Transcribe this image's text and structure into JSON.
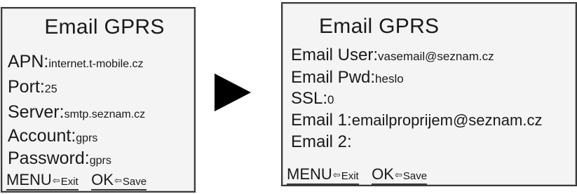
{
  "screens": [
    {
      "title": "Email GPRS",
      "fields": [
        {
          "label": "APN:",
          "value": "internet.t-mobile.cz"
        },
        {
          "label": "Port:",
          "value": "25"
        },
        {
          "label": "Server:",
          "value": "smtp.seznam.cz"
        },
        {
          "label": "Account:",
          "value": "gprs"
        },
        {
          "label": "Password:",
          "value": "gprs"
        }
      ],
      "softkeys": {
        "menu": "MENU",
        "exit": "Exit",
        "ok": "OK",
        "save": "Save",
        "arrow_glyph": "⇦"
      }
    },
    {
      "title": "Email GPRS",
      "fields": [
        {
          "label": "Email User:",
          "value": "vasemail@seznam.cz"
        },
        {
          "label": "Email Pwd:",
          "value": "heslo"
        },
        {
          "label": "SSL:",
          "value": "0"
        },
        {
          "label": "Email 1:",
          "value": "emailproprijem@seznam.cz"
        },
        {
          "label": "Email 2:",
          "value": ""
        }
      ],
      "softkeys": {
        "menu": "MENU",
        "exit": "Exit",
        "ok": "OK",
        "save": "Save",
        "arrow_glyph": "⇦"
      }
    }
  ],
  "transition_icon": "right-arrow-icon"
}
